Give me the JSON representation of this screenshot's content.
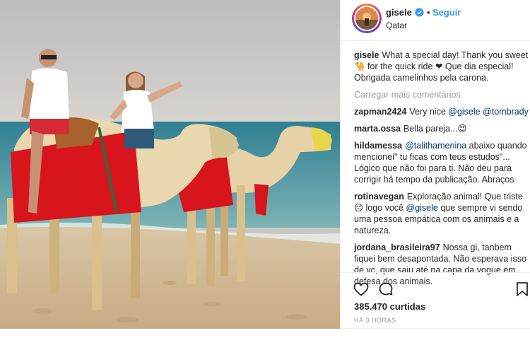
{
  "header": {
    "username": "gisele",
    "dot": "•",
    "follow_label": "Seguir",
    "location": "Qatar"
  },
  "caption": {
    "user": "gisele",
    "text": "What a special day! Thank you sweet 🐪 for the quick ride ❤ Que dia especial! Obrigada camelinhos pela carona."
  },
  "load_more_label": "Carregar mais comentários",
  "comments": [
    {
      "user": "zapman2424",
      "parts": [
        "Very nice ",
        "@gisele",
        " ",
        "@tombrady",
        ""
      ]
    },
    {
      "user": "marta.ossa",
      "parts": [
        "Bella pareja...😍",
        "",
        "",
        "",
        ""
      ]
    },
    {
      "user": "hildamessa",
      "parts": [
        "",
        "@talithamenina",
        " abaixo quando mencionei\" tu ficas com teus estudos\"... Lógico que não foi para ti. Não deu para corrigir há tempo da publicação. Abraços",
        "",
        ""
      ]
    },
    {
      "user": "rotinavegan",
      "parts": [
        "Exploração animal! Que triste 😔 logo você ",
        "@gisele",
        " que sempre vi sendo uma pessoa empática com os animais e a natureza.",
        "",
        ""
      ]
    },
    {
      "user": "jordana_brasileira97",
      "parts": [
        "Nossa gi, tanbem fiquei bem desapontada. Não esperava isso de vc, que saiu até na capa da vogue em defesa dos animais.",
        "",
        "",
        "",
        ""
      ]
    }
  ],
  "likes": "385.470 curtidas",
  "time": "HÁ 3 HORAS",
  "colors": {
    "accent": "#3897f0",
    "mention": "#003569",
    "muted": "#999999",
    "saddle_red": "#d8141d"
  }
}
